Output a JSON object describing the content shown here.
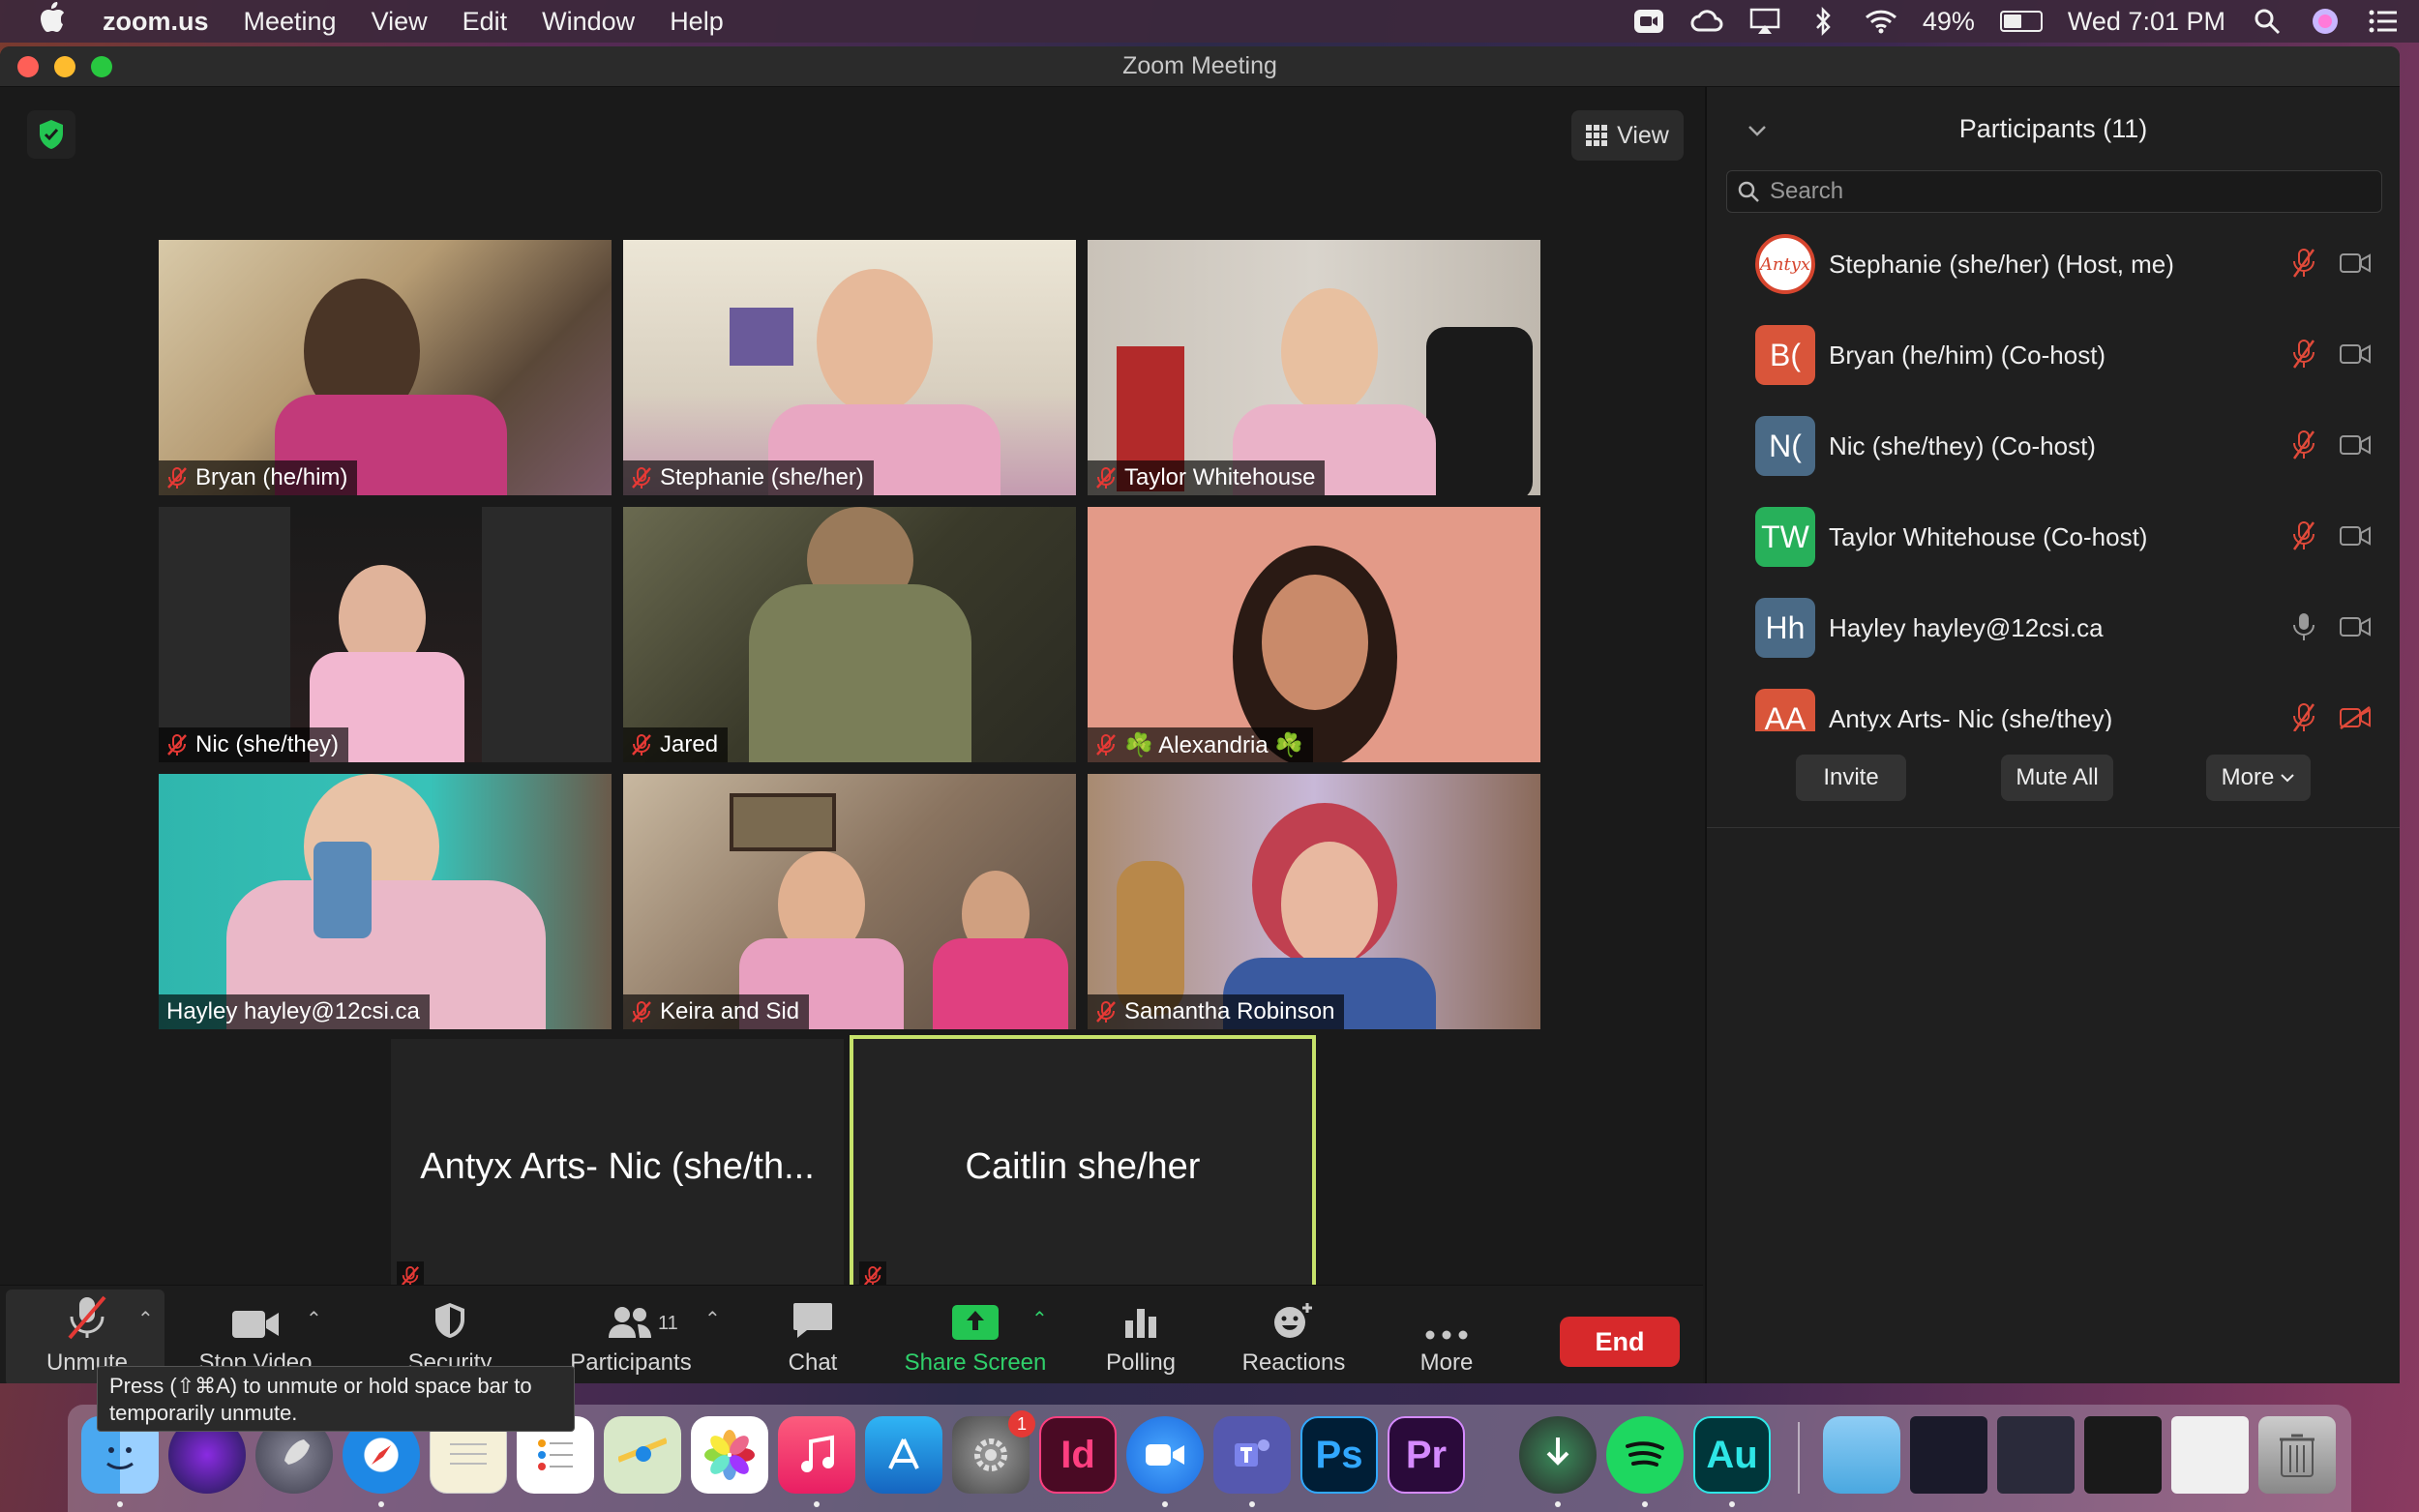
{
  "menubar": {
    "app_name": "zoom.us",
    "items": [
      "Meeting",
      "View",
      "Edit",
      "Window",
      "Help"
    ],
    "battery": "49%",
    "clock": "Wed 7:01 PM"
  },
  "window": {
    "title": "Zoom Meeting"
  },
  "meeting": {
    "view_label": "View",
    "tiles": [
      {
        "name": "Bryan (he/him)",
        "muted": true
      },
      {
        "name": "Stephanie (she/her)",
        "muted": true
      },
      {
        "name": "Taylor Whitehouse",
        "muted": true
      },
      {
        "name": "Nic (she/they)",
        "muted": true
      },
      {
        "name": "Jared",
        "muted": true
      },
      {
        "name": "☘️ Alexandria ☘️",
        "muted": true
      },
      {
        "name": "Hayley hayley@12csi.ca",
        "muted": false
      },
      {
        "name": "Keira and Sid",
        "muted": true
      },
      {
        "name": "Samantha Robinson",
        "muted": true
      }
    ],
    "blank_tiles": [
      {
        "name": "Antyx Arts- Nic (she/th...",
        "muted": true,
        "active": false
      },
      {
        "name": "Caitlin she/her",
        "muted": true,
        "active": true
      }
    ]
  },
  "toolbar": {
    "unmute": "Unmute",
    "stop_video": "Stop Video",
    "security": "Security",
    "participants": "Participants",
    "participants_count": "11",
    "chat": "Chat",
    "share_screen": "Share Screen",
    "polling": "Polling",
    "reactions": "Reactions",
    "more": "More",
    "end": "End"
  },
  "tooltip": {
    "text": "Press  (⇧⌘A) to unmute or hold space bar to temporarily unmute."
  },
  "panel": {
    "title": "Participants (11)",
    "search_placeholder": "Search",
    "participants": [
      {
        "initials": "Antyx",
        "name": "Stephanie (she/her) (Host, me)",
        "color": "#ffffff",
        "mic": "muted",
        "cam": "on"
      },
      {
        "initials": "B(",
        "name": "Bryan (he/him) (Co-host)",
        "color": "#d9553a",
        "mic": "muted",
        "cam": "on"
      },
      {
        "initials": "N(",
        "name": "Nic (she/they) (Co-host)",
        "color": "#4a6a86",
        "mic": "muted",
        "cam": "on"
      },
      {
        "initials": "TW",
        "name": "Taylor Whitehouse (Co-host)",
        "color": "#27b05a",
        "mic": "muted",
        "cam": "on"
      },
      {
        "initials": "Hh",
        "name": "Hayley hayley@12csi.ca",
        "color": "#4a6a86",
        "mic": "on",
        "cam": "on"
      },
      {
        "initials": "AA",
        "name": "Antyx Arts- Nic (she/they)",
        "color": "#d9553a",
        "mic": "muted",
        "cam": "off"
      }
    ],
    "invite": "Invite",
    "mute_all": "Mute All",
    "more": "More"
  },
  "dock": {
    "badge": "1",
    "apps": [
      "Id",
      "Ps",
      "Pr",
      "Au"
    ]
  }
}
